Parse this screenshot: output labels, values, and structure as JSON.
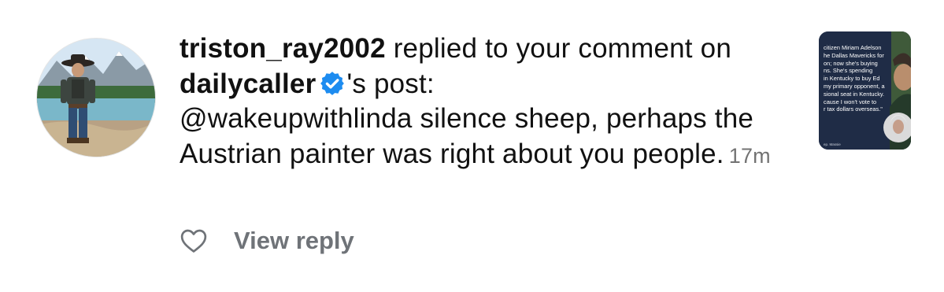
{
  "notification": {
    "username": "triston_ray2002",
    "action_text": " replied to your comment on ",
    "target_account": "dailycaller",
    "post_suffix": "'s post:",
    "comment_text": "@wakeupwithlinda silence sheep, perhaps the Austrian painter was right about you people.",
    "timestamp": "17m"
  },
  "actions": {
    "view_reply_label": "View reply"
  },
  "post_thumbnail": {
    "text": "citizen Miriam Adelson\nhe Dallas Mavericks for\non; now she's buying\nns. She's spending\nin Kentucky to buy Ed\nmy primary opponent, a\nsional seat in Kentucky.\ncause I won't vote to\nr tax dollars overseas.\"",
    "caption": "ep. Massie"
  },
  "colors": {
    "verified_badge": "#1d8cf0",
    "secondary_text": "#737373",
    "view_reply": "#6f7378",
    "thumbnail_bg": "#1f2c46"
  },
  "icons": {
    "verified": "verified-badge-icon",
    "like": "heart-outline-icon"
  }
}
